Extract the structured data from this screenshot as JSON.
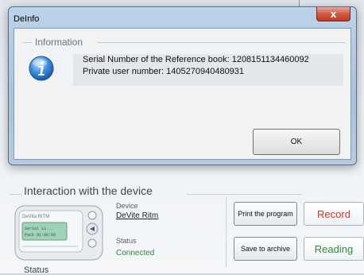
{
  "dialog": {
    "title": "DeInfo",
    "group_title": "Information",
    "message_line1": "Serial Number of the Reference book: 1208151134460092",
    "message_line2": "Private user number: 1405270940480931",
    "ok_label": "OK",
    "close_glyph": "x"
  },
  "main": {
    "group_title": "Interaction with the device",
    "device_label": "Device",
    "device_name": "DeVite Ritm",
    "status_label": "Status",
    "status_value": "Connected",
    "buttons": {
      "print": "Print the program",
      "record": "Record",
      "archive": "Save to archive",
      "reading": "Reading"
    },
    "status_heading": "Status"
  },
  "device_screen": {
    "brand": "DeVita RITM",
    "line1": "Serial 11...",
    "line2": "Pack 01:00:00"
  },
  "colors": {
    "record": "#d1342c",
    "reading": "#2f8c39",
    "connected": "#2b8a36"
  },
  "icons": [
    "info-icon",
    "close-icon"
  ]
}
